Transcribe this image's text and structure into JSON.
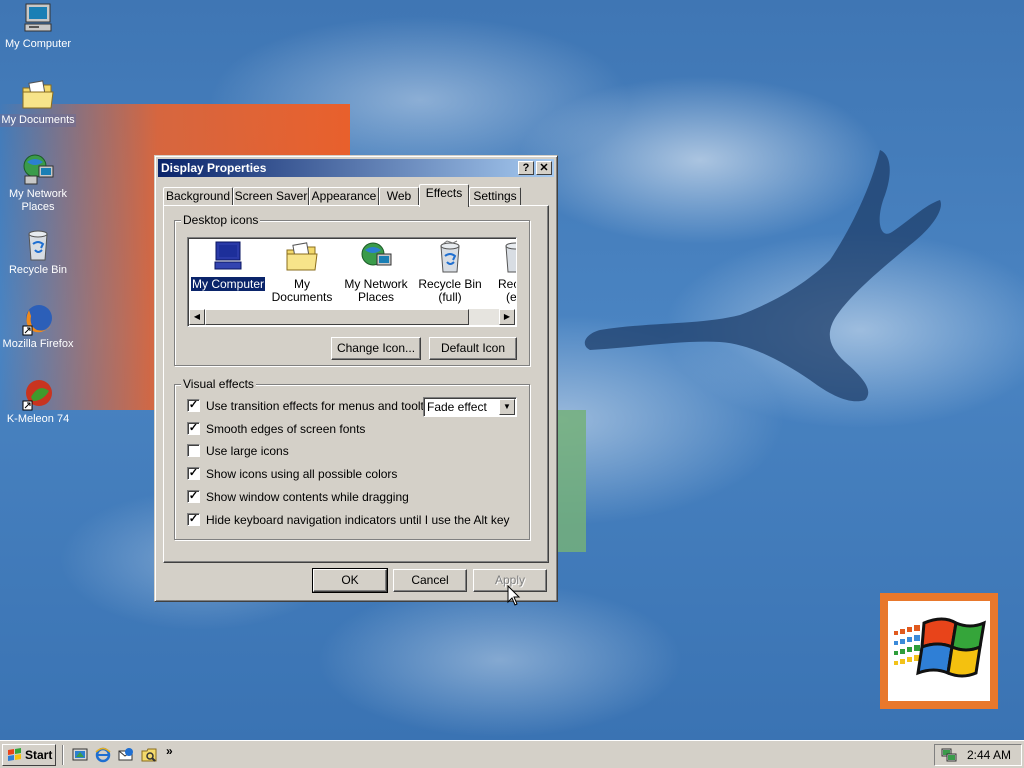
{
  "desktop": {
    "icons": [
      {
        "label": "My Computer",
        "icon": "my-computer-icon"
      },
      {
        "label": "My Documents",
        "icon": "my-documents-icon"
      },
      {
        "label": "My Network Places",
        "icon": "network-places-icon"
      },
      {
        "label": "Recycle Bin",
        "icon": "recycle-bin-icon"
      },
      {
        "label": "Mozilla Firefox",
        "icon": "firefox-icon"
      },
      {
        "label": "K-Meleon 74",
        "icon": "k-meleon-icon"
      }
    ]
  },
  "window": {
    "title": "Display Properties",
    "help_btn": "?",
    "close_btn": "✕",
    "tabs": [
      {
        "label": "Background"
      },
      {
        "label": "Screen Saver"
      },
      {
        "label": "Appearance"
      },
      {
        "label": "Web"
      },
      {
        "label": "Effects",
        "active": true
      },
      {
        "label": "Settings"
      }
    ],
    "desktop_icons_group": {
      "title": "Desktop icons",
      "items": [
        {
          "label": "My Computer",
          "selected": true,
          "icon": "my-computer-icon"
        },
        {
          "label": "My Documents",
          "icon": "my-documents-icon"
        },
        {
          "label_line1": "My Network",
          "label_line2": "Places",
          "icon": "network-places-icon"
        },
        {
          "label_line1": "Recycle Bin",
          "label_line2": "(full)",
          "icon": "recycle-bin-full-icon"
        },
        {
          "label_line1": "Recy",
          "label_line2": "(e",
          "icon": "recycle-bin-empty-icon"
        }
      ],
      "change_icon": "Change Icon...",
      "default_icon": "Default Icon"
    },
    "visual_effects_group": {
      "title": "Visual effects",
      "options": [
        {
          "label": "Use transition effects for menus and tooltips",
          "checked": true
        },
        {
          "label": "Smooth edges of screen fonts",
          "checked": true
        },
        {
          "label": "Use large icons",
          "checked": false
        },
        {
          "label": "Show icons using all possible colors",
          "checked": true
        },
        {
          "label": "Show window contents while dragging",
          "checked": true
        },
        {
          "label": "Hide keyboard navigation indicators until I use the Alt key",
          "checked": true
        }
      ],
      "transition_select": "Fade effect"
    },
    "buttons": {
      "ok": "OK",
      "cancel": "Cancel",
      "apply": "Apply"
    }
  },
  "taskbar": {
    "start": "Start",
    "quick_launch": [
      "show-desktop-icon",
      "internet-explorer-icon",
      "outlook-express-icon",
      "windows-explorer-icon"
    ],
    "chevron": "»",
    "clock": "2:44 AM"
  },
  "colors": {
    "titlebar_start": "#0a246a",
    "titlebar_end": "#a6caf0",
    "face": "#d4d0c8",
    "desktop": "#3a6ea5"
  }
}
